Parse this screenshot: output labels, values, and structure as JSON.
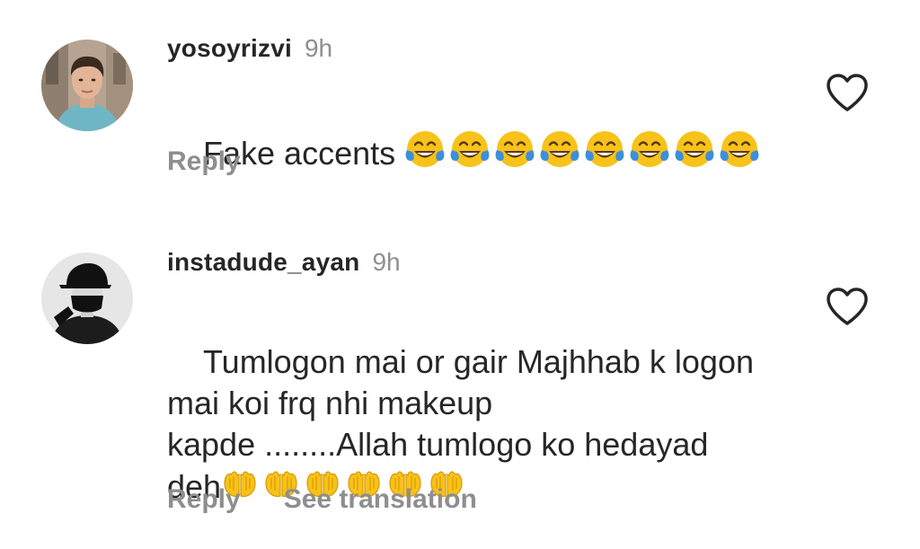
{
  "comments": [
    {
      "username": "yosoyrizvi",
      "time": "9h",
      "text": "Fake accents ",
      "emoji_name": "face-with-tears-of-joy",
      "emoji_count": 8,
      "actions": [
        "Reply"
      ]
    },
    {
      "username": "instadude_ayan",
      "time": "9h",
      "text": "Tumlogon mai or gair Majhhab k logon\nmai koi frq nhi makeup\nkapde ........Allah tumlogo ko hedayad\ndeh",
      "emoji_name": "palms-up-together",
      "emoji_count": 6,
      "actions": [
        "Reply",
        "See translation"
      ]
    }
  ],
  "colors": {
    "text": "#262626",
    "muted": "#8e8e8e",
    "emoji_yellow": "#f7c21a"
  },
  "icons": {
    "like": "heart-outline-icon"
  }
}
